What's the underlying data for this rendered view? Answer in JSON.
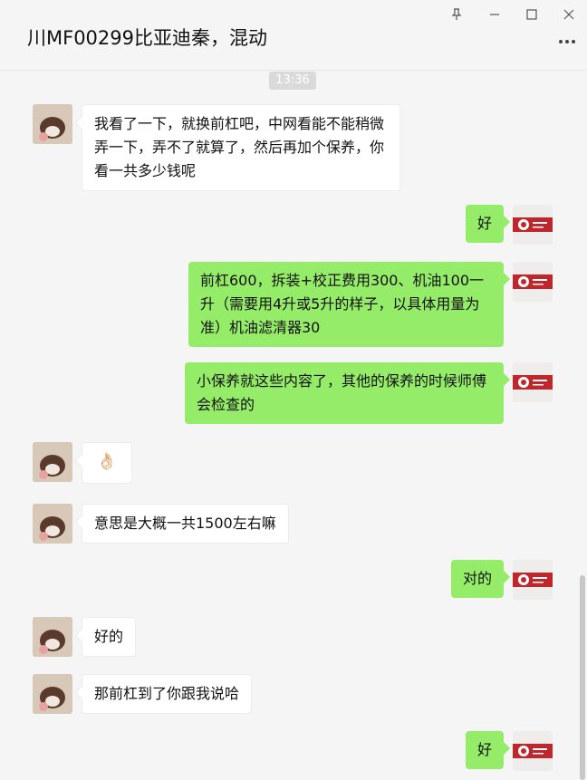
{
  "window": {
    "title": "川MF00299比亚迪秦，混动",
    "controls": {
      "pin": "pin-icon",
      "minimize": "minimize-icon",
      "maximize": "maximize-icon",
      "close": "close-icon",
      "more": "more-icon"
    }
  },
  "chat": {
    "timestamp": "13:36",
    "messages": [
      {
        "side": "left",
        "text": "我看了一下，就换前杠吧，中网看能不能稍微弄一下，弄不了就算了，然后再加个保养，你看一共多少钱呢"
      },
      {
        "side": "right",
        "text": "好"
      },
      {
        "side": "right",
        "text": "前杠600，拆装+校正费用300、机油100一升（需要用4升或5升的样子，以具体用量为准）机油滤清器30"
      },
      {
        "side": "right",
        "text": "小保养就这些内容了，其他的保养的时候师傅会检查的"
      },
      {
        "side": "left",
        "text": "👌🏻"
      },
      {
        "side": "left",
        "text": "意思是大概一共1500左右嘛"
      },
      {
        "side": "right",
        "text": "对的"
      },
      {
        "side": "left",
        "text": "好的"
      },
      {
        "side": "left",
        "text": "那前杠到了你跟我说哈"
      },
      {
        "side": "right",
        "text": "好"
      }
    ]
  },
  "colors": {
    "sent_bubble": "#95ec69",
    "received_bubble": "#ffffff",
    "background": "#f5f5f5"
  }
}
